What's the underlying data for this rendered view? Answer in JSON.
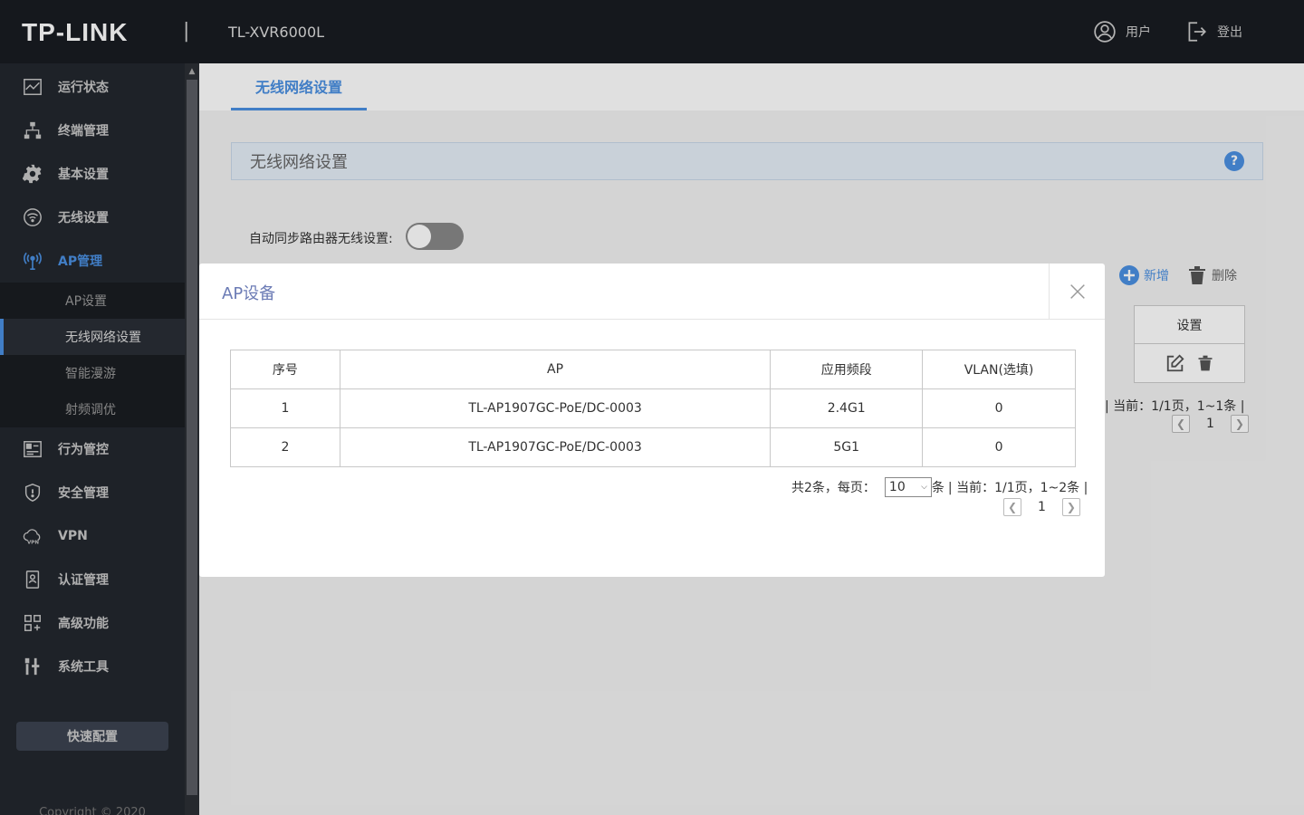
{
  "header": {
    "logo": "TP-LINK",
    "separator": "|",
    "model": "TL-XVR6000L",
    "user_label": "用户",
    "logout_label": "登出"
  },
  "sidebar": {
    "items": [
      {
        "label": "运行状态",
        "icon": "chart-icon"
      },
      {
        "label": "终端管理",
        "icon": "network-icon"
      },
      {
        "label": "基本设置",
        "icon": "gear-icon"
      },
      {
        "label": "无线设置",
        "icon": "wifi-icon"
      },
      {
        "label": "AP管理",
        "icon": "antenna-icon"
      },
      {
        "label": "行为管控",
        "icon": "control-icon"
      },
      {
        "label": "安全管理",
        "icon": "shield-icon"
      },
      {
        "label": "VPN",
        "icon": "vpn-icon"
      },
      {
        "label": "认证管理",
        "icon": "auth-icon"
      },
      {
        "label": "高级功能",
        "icon": "grid-icon"
      },
      {
        "label": "系统工具",
        "icon": "tools-icon"
      }
    ],
    "subitems": [
      "AP设置",
      "无线网络设置",
      "智能漫游",
      "射频调优"
    ],
    "quick_config": "快速配置",
    "copyright": "Copyright © 2020"
  },
  "main": {
    "tab": "无线网络设置",
    "section_title": "无线网络设置",
    "help": "?",
    "sync_label": "自动同步路由器无线设置:",
    "add_label": "新增",
    "delete_label": "删除",
    "bg_table_header": "设置",
    "bg_pager_text": "| 当前：1/1页，1~1条 |",
    "bg_page_num": "1"
  },
  "dialog": {
    "title": "AP设备",
    "columns": [
      "序号",
      "AP",
      "应用频段",
      "VLAN(选填)"
    ],
    "rows": [
      [
        "1",
        "TL-AP1907GC-PoE/DC-0003",
        "2.4G1",
        "0"
      ],
      [
        "2",
        "TL-AP1907GC-PoE/DC-0003",
        "5G1",
        "0"
      ]
    ],
    "pager": {
      "total_label": "共2条，每页：",
      "page_size": "10",
      "unit": "条",
      "current": "| 当前：1/1页，1~2条 |",
      "page": "1"
    }
  },
  "colors": {
    "accent": "#4a90e2",
    "header_bg": "#191c22",
    "sidebar_bg": "#23272e"
  }
}
